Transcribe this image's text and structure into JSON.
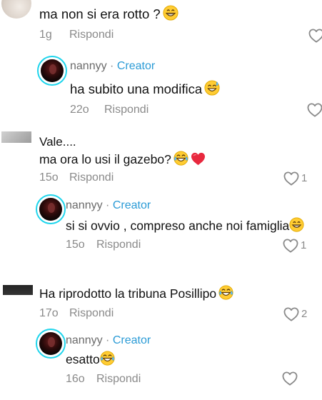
{
  "comments": [
    {
      "text": "ma non si era rotto ?",
      "emoji": "grin",
      "time": "1g",
      "reply": "Rispondi"
    },
    {
      "username": "nannyy",
      "separator": "·",
      "creator_tag": "Creator",
      "text": "ha subito una modifica",
      "emoji": "sweat-smile",
      "time": "22o",
      "reply": "Rispondi"
    },
    {
      "username": "Vale....",
      "text": "ma ora lo usi il gazebo?",
      "emojis": [
        "tears-of-joy",
        "red-heart"
      ],
      "time": "15o",
      "reply": "Rispondi",
      "likes": "1"
    },
    {
      "username": "nannyy",
      "separator": "·",
      "creator_tag": "Creator",
      "text": "si si ovvio , compreso anche noi famiglia",
      "emoji": "grin",
      "time": "15o",
      "reply": "Rispondi",
      "likes": "1"
    },
    {
      "text": "Ha riprodotto la tribuna Posillipo",
      "emoji": "tears-of-joy",
      "time": "17o",
      "reply": "Rispondi",
      "likes": "2"
    },
    {
      "username": "nannyy",
      "separator": "·",
      "creator_tag": "Creator",
      "text": "esatto",
      "emoji": "tears-of-joy",
      "time": "16o",
      "reply": "Rispondi"
    }
  ],
  "colors": {
    "creator_ring": "#20d5ec",
    "creator_tag": "#2b9bd6",
    "heart_red": "#e8283e",
    "meta_gray": "#8a8a8a"
  },
  "icons": {
    "like": "heart-outline-icon",
    "red_heart": "red-heart-emoji-icon",
    "grin": "grinning-face-emoji-icon",
    "sweat_smile": "sweat-smile-emoji-icon",
    "tears_of_joy": "tears-of-joy-emoji-icon"
  }
}
